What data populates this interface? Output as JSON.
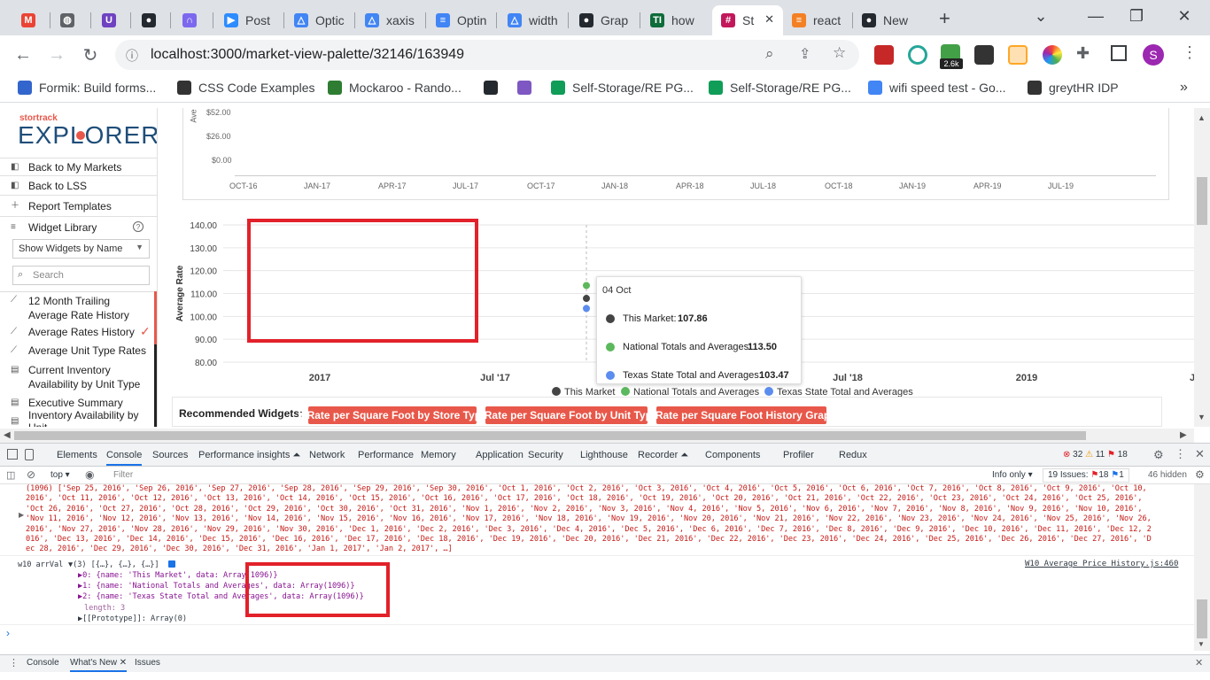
{
  "browser": {
    "tabs": [
      {
        "title": "",
        "fav_color": "#ea4335",
        "fav_glyph": "M"
      },
      {
        "title": "",
        "fav_color": "#5f6368",
        "fav_glyph": "◍"
      },
      {
        "title": "",
        "fav_color": "#6f42c1",
        "fav_glyph": "U"
      },
      {
        "title": "",
        "fav_color": "#24292f",
        "fav_glyph": "●"
      },
      {
        "title": "",
        "fav_color": "#7b68ee",
        "fav_glyph": "∩"
      },
      {
        "title": "Post",
        "fav_color": "#2d8cff",
        "fav_glyph": "▶"
      },
      {
        "title": "Optic",
        "fav_color": "#4285f4",
        "fav_glyph": "△"
      },
      {
        "title": "xaxis",
        "fav_color": "#4285f4",
        "fav_glyph": "△"
      },
      {
        "title": "Optin",
        "fav_color": "#4285f4",
        "fav_glyph": "≡"
      },
      {
        "title": "width",
        "fav_color": "#4285f4",
        "fav_glyph": "△"
      },
      {
        "title": "Grap",
        "fav_color": "#24292f",
        "fav_glyph": "●"
      },
      {
        "title": "how",
        "fav_color": "#0e6b3a",
        "fav_glyph": "TI"
      },
      {
        "title": "St",
        "fav_color": "#c2185b",
        "fav_glyph": "#",
        "active": true
      },
      {
        "title": "react",
        "fav_color": "#f48024",
        "fav_glyph": "≡"
      },
      {
        "title": "New",
        "fav_color": "#24292f",
        "fav_glyph": "●"
      }
    ],
    "new_tab": "+",
    "url": "localhost:3000/market-view-palette/32146/163949",
    "bookmarks": [
      {
        "label": "Formik: Build forms...",
        "color": "#3366cc"
      },
      {
        "label": "CSS Code Examples",
        "color": "#333333"
      },
      {
        "label": "Mockaroo - Rando...",
        "color": "#2e7d32"
      },
      {
        "label": "",
        "color": "#24292f"
      },
      {
        "label": "",
        "color": "#7e57c2"
      },
      {
        "label": "Self-Storage/RE PG...",
        "color": "#0f9d58"
      },
      {
        "label": "Self-Storage/RE PG...",
        "color": "#0f9d58"
      },
      {
        "label": "wifi speed test - Go...",
        "color": "#4285f4"
      },
      {
        "label": "greytHR IDP",
        "color": "#333333"
      }
    ],
    "bookmarks_more": "»",
    "ext_badge": "2.6k",
    "profile_initial": "S"
  },
  "app": {
    "logo_small": "stortrack",
    "logo": "EXPLORER",
    "sidebar": {
      "links": [
        "Back to My Markets",
        "Back to LSS",
        "Report Templates",
        "Widget Library"
      ],
      "select_value": "Show Widgets by Name",
      "search_placeholder": "Search",
      "widgets": [
        "12 Month Trailing Average Rate History",
        "Average Rates History",
        "Average Unit Type Rates",
        "Current Inventory Availability by Unit Type",
        "Executive Summary",
        "Inventory Availability by Unit"
      ]
    },
    "top_chart": {
      "ylabel": "Ave",
      "yticks": [
        "$52.00",
        "$26.00",
        "$0.00"
      ],
      "xticks": [
        "OCT-16",
        "JAN-17",
        "APR-17",
        "JUL-17",
        "OCT-17",
        "JAN-18",
        "APR-18",
        "JUL-18",
        "OCT-18",
        "JAN-19",
        "APR-19",
        "JUL-19"
      ]
    },
    "chart_data": {
      "type": "line",
      "ylabel": "Average Rate",
      "ylim": [
        80,
        140
      ],
      "yticks": [
        "140.00",
        "130.00",
        "120.00",
        "110.00",
        "100.00",
        "90.00",
        "80.00"
      ],
      "xticks": [
        "2017",
        "Jul '17",
        "Jul '18",
        "2019",
        "J"
      ],
      "series": [
        {
          "name": "This Market",
          "color": "#444444",
          "points": [
            {
              "x": "04 Oct",
              "y": 107.86
            }
          ]
        },
        {
          "name": "National Totals and Averages",
          "color": "#5cb85c",
          "points": [
            {
              "x": "04 Oct",
              "y": 113.5
            }
          ]
        },
        {
          "name": "Texas State Total and Averages",
          "color": "#5b8def",
          "points": [
            {
              "x": "04 Oct",
              "y": 103.47
            }
          ]
        }
      ],
      "tooltip": {
        "title": "04 Oct",
        "rows": [
          {
            "label": "This Market:",
            "value": "107.86"
          },
          {
            "label": "National Totals and Averages:",
            "value": "113.50"
          },
          {
            "label": "Texas State Total and Averages:",
            "value": "103.47"
          }
        ]
      },
      "legend": [
        "This Market",
        "National Totals and Averages",
        "Texas State Total and Averages"
      ]
    },
    "recommended": {
      "label": "Recommended Widgets:",
      "buttons": [
        "+ Rate per Square Foot by Store Type",
        "+ Rate per Square Foot by Unit Type",
        "+ Rate per Square Foot History Graph"
      ]
    }
  },
  "devtools": {
    "tabs": [
      "Elements",
      "Console",
      "Sources",
      "Performance insights ⏶",
      "Network",
      "Performance",
      "Memory",
      "Application",
      "Security",
      "Lighthouse",
      "Recorder ⏶",
      "Components",
      "Profiler",
      "Redux"
    ],
    "errors": "32",
    "warnings": "11",
    "issues_badge": "18",
    "context": "top",
    "filter_placeholder": "Filter",
    "level": "Info only",
    "issues_text": "19 Issues:",
    "issues_err": "18",
    "issues_info": "1",
    "hidden": "46 hidden",
    "console_lines": [
      "(1096) ['Sep 25, 2016', 'Sep 26, 2016', 'Sep 27, 2016', 'Sep 28, 2016', 'Sep 29, 2016', 'Sep 30, 2016', 'Oct 1, 2016', 'Oct 2, 2016', 'Oct 3, 2016', 'Oct 4, 2016', 'Oct 5, 2016', 'Oct 6, 2016', 'Oct 7, 2016', 'Oct 8, 2016', 'Oct 9, 2016', 'Oct 10,",
      "2016', 'Oct 11, 2016', 'Oct 12, 2016', 'Oct 13, 2016', 'Oct 14, 2016', 'Oct 15, 2016', 'Oct 16, 2016', 'Oct 17, 2016', 'Oct 18, 2016', 'Oct 19, 2016', 'Oct 20, 2016', 'Oct 21, 2016', 'Oct 22, 2016', 'Oct 23, 2016', 'Oct 24, 2016', 'Oct 25, 2016',",
      "'Oct 26, 2016', 'Oct 27, 2016', 'Oct 28, 2016', 'Oct 29, 2016', 'Oct 30, 2016', 'Oct 31, 2016', 'Nov 1, 2016', 'Nov 2, 2016', 'Nov 3, 2016', 'Nov 4, 2016', 'Nov 5, 2016', 'Nov 6, 2016', 'Nov 7, 2016', 'Nov 8, 2016', 'Nov 9, 2016', 'Nov 10, 2016',",
      "'Nov 11, 2016', 'Nov 12, 2016', 'Nov 13, 2016', 'Nov 14, 2016', 'Nov 15, 2016', 'Nov 16, 2016', 'Nov 17, 2016', 'Nov 18, 2016', 'Nov 19, 2016', 'Nov 20, 2016', 'Nov 21, 2016', 'Nov 22, 2016', 'Nov 23, 2016', 'Nov 24, 2016', 'Nov 25, 2016', 'Nov 26,",
      "2016', 'Nov 27, 2016', 'Nov 28, 2016', 'Nov 29, 2016', 'Nov 30, 2016', 'Dec 1, 2016', 'Dec 2, 2016', 'Dec 3, 2016', 'Dec 4, 2016', 'Dec 5, 2016', 'Dec 6, 2016', 'Dec 7, 2016', 'Dec 8, 2016', 'Dec 9, 2016', 'Dec 10, 2016', 'Dec 11, 2016', 'Dec 12, 2",
      "016', 'Dec 13, 2016', 'Dec 14, 2016', 'Dec 15, 2016', 'Dec 16, 2016', 'Dec 17, 2016', 'Dec 18, 2016', 'Dec 19, 2016', 'Dec 20, 2016', 'Dec 21, 2016', 'Dec 22, 2016', 'Dec 23, 2016', 'Dec 24, 2016', 'Dec 25, 2016', 'Dec 26, 2016', 'Dec 27, 2016', 'D",
      "ec 28, 2016', 'Dec 29, 2016', 'Dec 30, 2016', 'Dec 31, 2016', 'Jan 1, 2017', 'Jan 2, 2017', …]"
    ],
    "log_prefix": "w10 arrVal",
    "log_summary": "▼(3) [{…}, {…}, {…}]",
    "source_link": "W10 Average Price History.js:460",
    "array_rows": [
      "▶0: {name: 'This Market', data: Array(1096)}",
      "▶1: {name: 'National Totals and Averages', data: Array(1096)}",
      "▶2: {name: 'Texas State Total and Averages', data: Array(1096)}"
    ],
    "length_row": "length: 3",
    "proto_row": "▶[[Prototype]]: Array(0)",
    "prompt": "›",
    "drawer_tabs": [
      "Console",
      "What's New ✕",
      "Issues"
    ]
  }
}
